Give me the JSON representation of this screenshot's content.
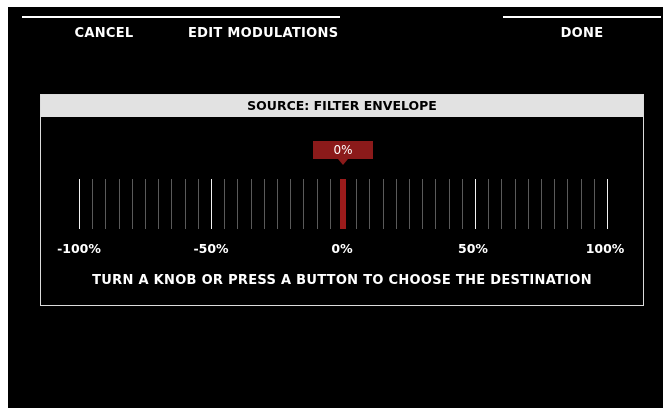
{
  "header": {
    "cancel_label": "CANCEL",
    "title": "EDIT MODULATIONS",
    "done_label": "DONE"
  },
  "dialog": {
    "title": "SOURCE: FILTER ENVELOPE",
    "value_label": "0%",
    "value": 0,
    "scale_labels": [
      "-100%",
      "-50%",
      "0%",
      "50%",
      "100%"
    ],
    "instruction": "TURN A KNOB OR PRESS A BUTTON TO CHOOSE THE DESTINATION"
  },
  "colors": {
    "accent": "#8b1a1a",
    "header_bg": "#e2e2e2"
  }
}
